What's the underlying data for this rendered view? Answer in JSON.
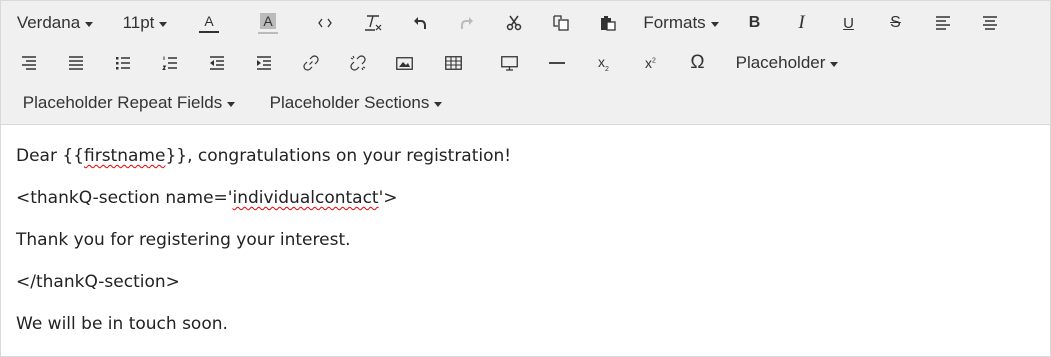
{
  "toolbar": {
    "font_family": "Verdana",
    "font_size": "11pt",
    "text_color_glyph": "A",
    "bg_color_glyph": "A",
    "formats_label": "Formats",
    "bold_glyph": "B",
    "italic_glyph": "I",
    "underline_glyph": "U",
    "strike_glyph": "S",
    "subscript_glyph": "x",
    "subscript_mark": "2",
    "superscript_glyph": "x",
    "superscript_mark": "2",
    "omega_glyph": "Ω",
    "placeholder_label": "Placeholder",
    "placeholder_repeat_label": "Placeholder Repeat Fields",
    "placeholder_sections_label": "Placeholder Sections"
  },
  "content": {
    "line1_prefix": "Dear {{",
    "line1_token": "firstname",
    "line1_suffix": "}}, congratulations on your registration!",
    "line2_prefix": "<thankQ-section name='",
    "line2_token": "individualcontact",
    "line2_suffix": "'>",
    "line3": "Thank you for registering your interest.",
    "line4": "</thankQ-section>",
    "line5": "We will be in touch soon."
  }
}
